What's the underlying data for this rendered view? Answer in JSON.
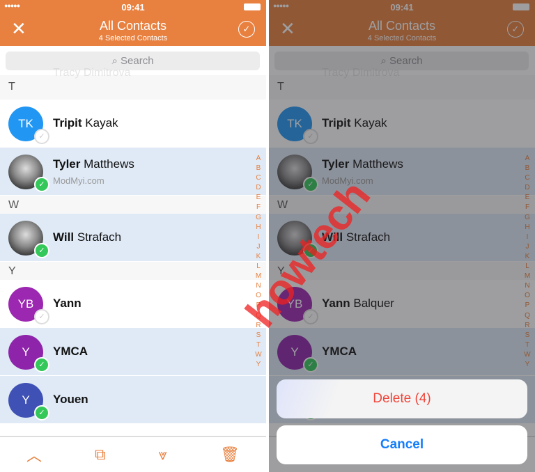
{
  "status": {
    "time": "09:41",
    "signal": "●●●●●"
  },
  "nav": {
    "title": "All Contacts",
    "subtitle": "4 Selected Contacts",
    "close_icon": "close-icon",
    "done_icon": "check-circle-icon"
  },
  "search": {
    "placeholder": "Search"
  },
  "ghost_contact": "Tracy Dimitrova",
  "sections": [
    {
      "letter": "T",
      "contacts": [
        {
          "first": "Tripit",
          "last": "Kayak",
          "initials": "TK",
          "color": "#2196F3",
          "selected": false
        }
      ]
    },
    {
      "letter": "",
      "contacts": [
        {
          "first": "Tyler",
          "last": "Matthews",
          "subtitle": "ModMyi.com",
          "photo": true,
          "selected": true
        }
      ]
    },
    {
      "letter": "W",
      "contacts": [
        {
          "first": "Will",
          "last": "Strafach",
          "photo": true,
          "selected": true
        }
      ]
    },
    {
      "letter": "Y",
      "contacts": [
        {
          "first": "Yann",
          "last": "",
          "last_right": "Balquer",
          "initials": "YB",
          "color": "#9C27B0",
          "selected": false
        },
        {
          "first": "YMCA",
          "last": "",
          "initials": "Y",
          "color": "#8E24AA",
          "selected": true
        },
        {
          "first": "Youen",
          "last": "",
          "initials": "Y",
          "color": "#3F51B5",
          "selected": true
        }
      ]
    }
  ],
  "index": [
    "A",
    "B",
    "C",
    "D",
    "E",
    "F",
    "G",
    "H",
    "I",
    "J",
    "K",
    "L",
    "M",
    "N",
    "O",
    "P",
    "Q",
    "R",
    "S",
    "T",
    "W",
    "Y"
  ],
  "toolbar": {
    "icons": [
      "chevron-up-icon",
      "copy-icon",
      "merge-icon",
      "trash-icon"
    ],
    "glyphs": [
      "︿",
      "⧉",
      "⩔",
      "🗑"
    ]
  },
  "action_sheet": {
    "delete": "Delete (4)",
    "cancel": "Cancel"
  },
  "watermark": "howtech",
  "colors": {
    "accent": "#E8803F",
    "selected_row": "#dfeaf6",
    "check": "#34C759",
    "destructive": "#f0453a",
    "link": "#157efb"
  }
}
